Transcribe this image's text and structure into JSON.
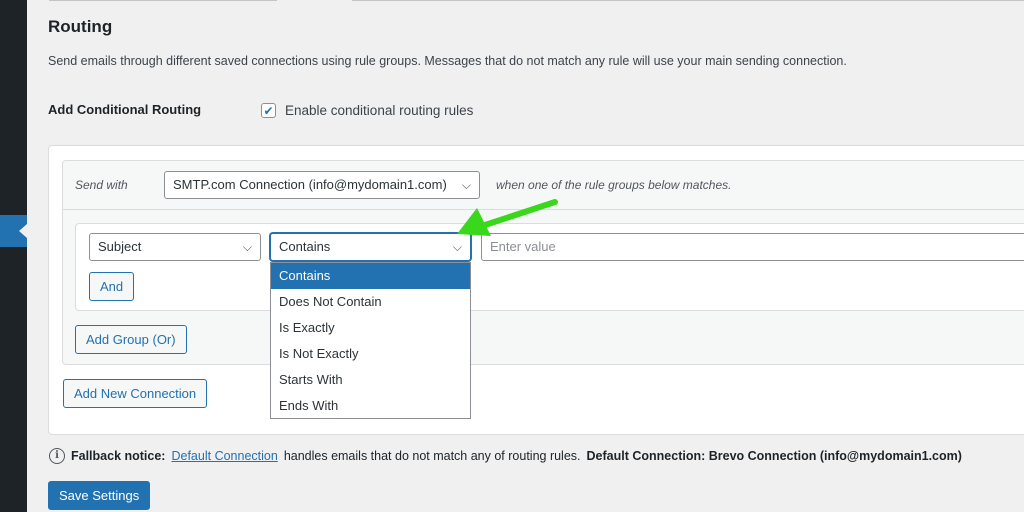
{
  "page": {
    "title": "Routing",
    "description": "Send emails through different saved connections using rule groups. Messages that do not match any rule will use your main sending connection."
  },
  "conditional": {
    "label": "Add Conditional Routing",
    "enable_label": "Enable conditional routing rules",
    "enabled": true
  },
  "group": {
    "send_with": "Send with",
    "connection": "SMTP.com Connection (info@mydomain1.com)",
    "when_text": "when one of the rule groups below matches."
  },
  "rule": {
    "field": "Subject",
    "operator": "Contains",
    "value_placeholder": "Enter value",
    "and_label": "And"
  },
  "operator_options": [
    "Contains",
    "Does Not Contain",
    "Is Exactly",
    "Is Not Exactly",
    "Starts With",
    "Ends With"
  ],
  "selected_operator_index": 0,
  "buttons": {
    "add_group": "Add Group (Or)",
    "add_connection": "Add New Connection",
    "save": "Save Settings"
  },
  "fallback": {
    "label": "Fallback notice:",
    "link": "Default Connection",
    "text": "handles emails that do not match any of routing rules.",
    "default_info": "Default Connection: Brevo Connection (info@mydomain1.com)"
  },
  "icons": {
    "check": "checkmark-icon",
    "chevron": "chevron-down-icon",
    "info": "info-icon",
    "annotation": "green-arrow-icon"
  },
  "colors": {
    "accent": "#2271b1",
    "sidebar": "#1d2327",
    "annotation": "#3ad81c"
  }
}
